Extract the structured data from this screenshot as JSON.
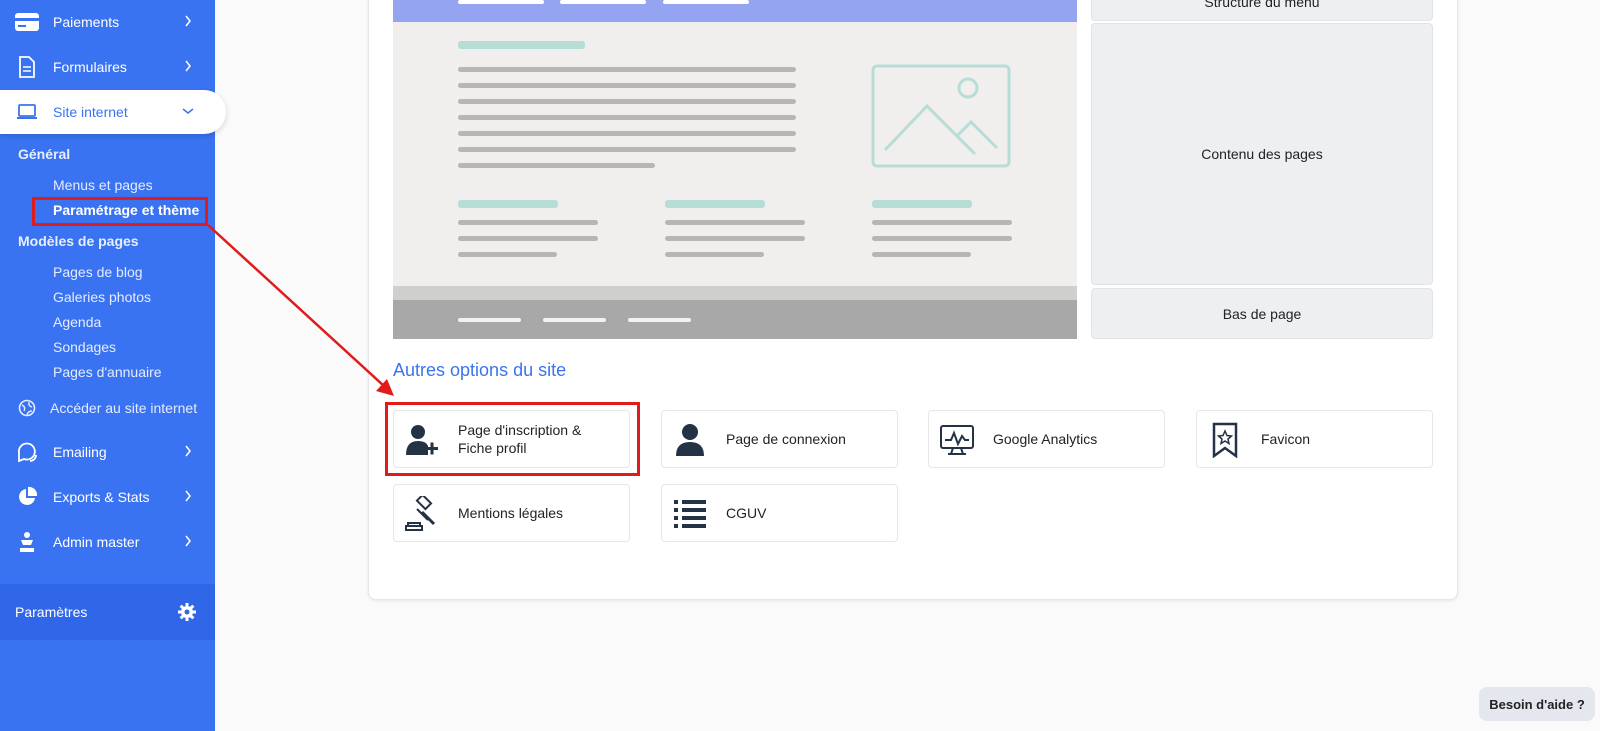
{
  "sidebar": {
    "items": [
      {
        "label": "Paiements",
        "icon": "card-icon"
      },
      {
        "label": "Formulaires",
        "icon": "document-icon"
      },
      {
        "label": "Site internet",
        "icon": "laptop-icon"
      },
      {
        "label": "Emailing",
        "icon": "chat-bubbles-icon"
      },
      {
        "label": "Exports & Stats",
        "icon": "pie-chart-icon"
      },
      {
        "label": "Admin master",
        "icon": "admin-icon"
      }
    ],
    "sections": {
      "general": "Général",
      "general_links": [
        "Menus et pages",
        "Paramétrage et thème"
      ],
      "templates": "Modèles de pages",
      "template_links": [
        "Pages de blog",
        "Galeries photos",
        "Agenda",
        "Sondages",
        "Pages d'annuaire"
      ]
    },
    "access_site": "Accéder au site internet",
    "settings": "Paramètres"
  },
  "main": {
    "right_tiles": [
      "Structure du menu",
      "Contenu des pages",
      "Bas de page"
    ],
    "section_title": "Autres options du site",
    "options": [
      {
        "label": "Page d'inscription & Fiche profil",
        "icon": "user-add-icon"
      },
      {
        "label": "Page de connexion",
        "icon": "user-icon"
      },
      {
        "label": "Google Analytics",
        "icon": "analytics-monitor-icon"
      },
      {
        "label": "Favicon",
        "icon": "bookmark-star-icon"
      },
      {
        "label": "Mentions légales",
        "icon": "gavel-icon"
      },
      {
        "label": "CGUV",
        "icon": "list-icon"
      }
    ]
  },
  "help": {
    "label": "Besoin d'aide ?"
  },
  "colors": {
    "brand": "#3a73f1",
    "highlight": "#e11b1b",
    "preview_teal": "#b6ddd6"
  }
}
